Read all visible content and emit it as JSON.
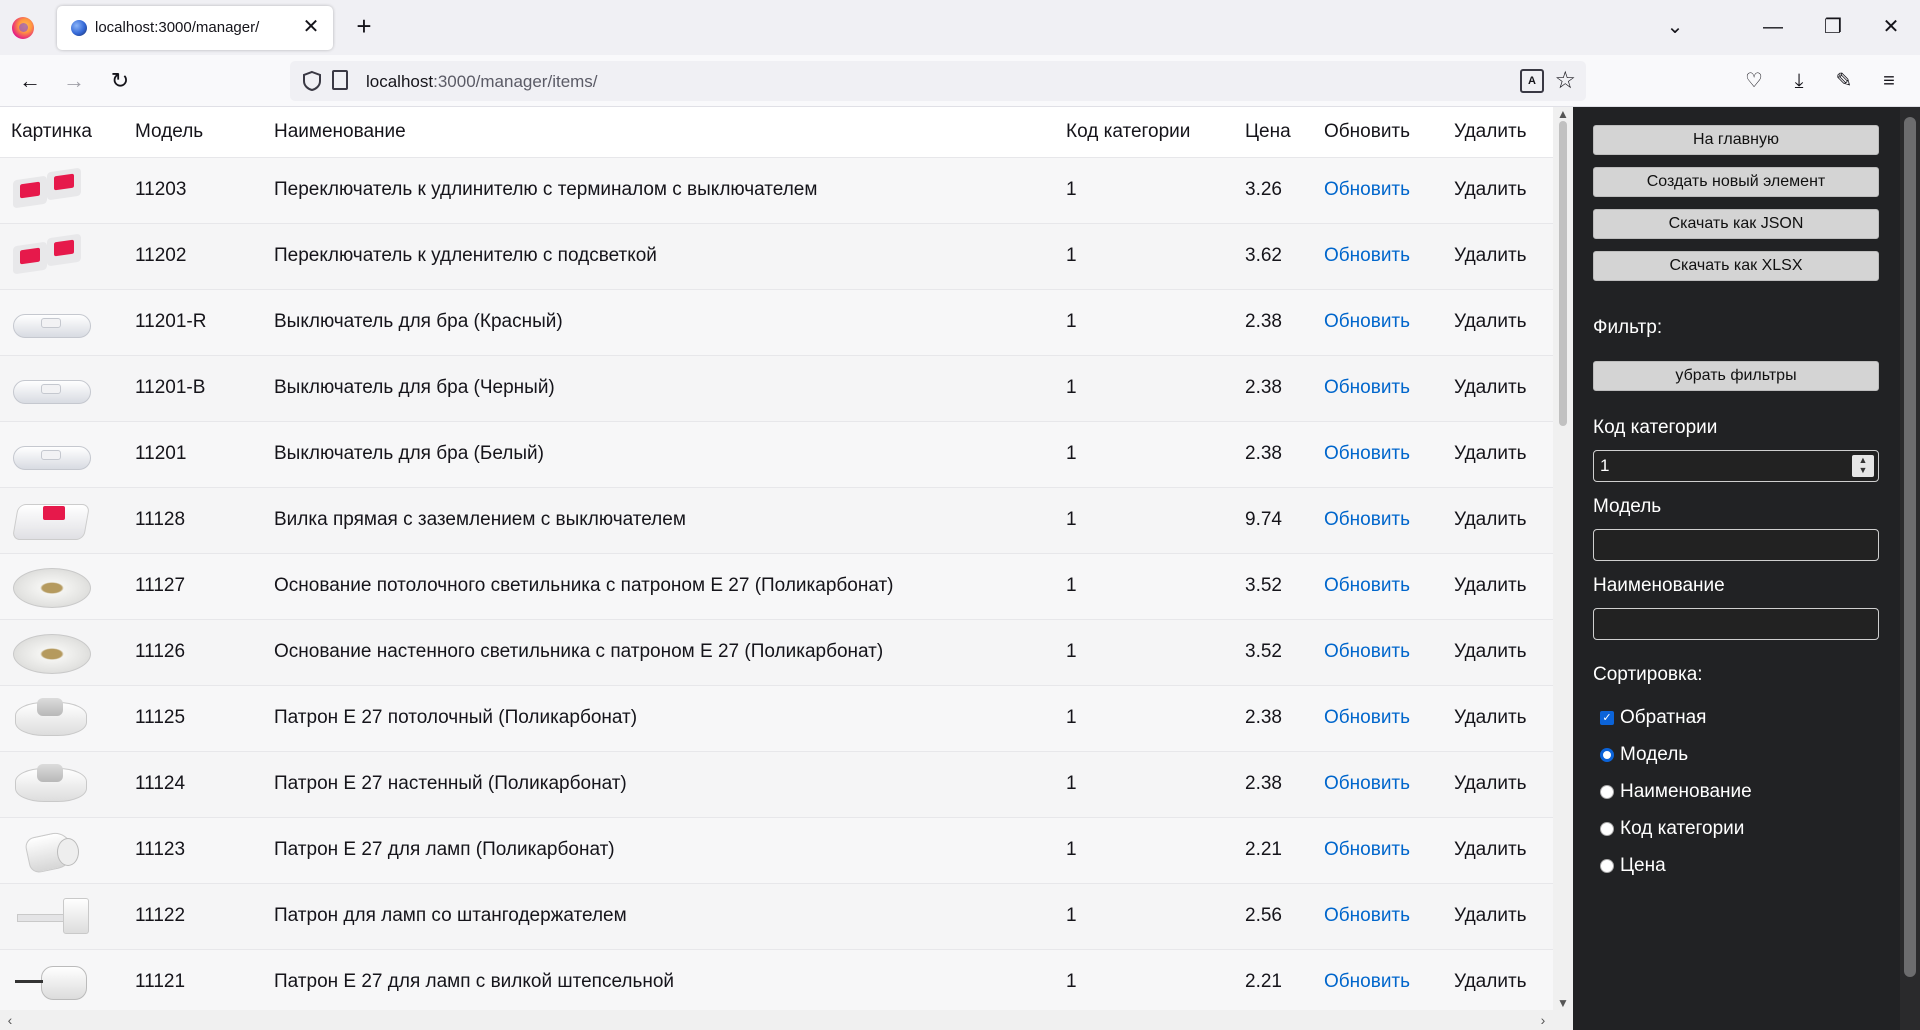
{
  "browser": {
    "tab_title": "localhost:3000/manager/",
    "tab_close": "✕",
    "new_tab": "+",
    "url_host": "localhost",
    "url_rest": ":3000/manager/items/",
    "win_min": "—",
    "win_max": "❐",
    "win_close": "✕",
    "list_tabs": "⌄"
  },
  "table": {
    "headers": {
      "image": "Картинка",
      "model": "Модель",
      "name": "Наименование",
      "category": "Код категории",
      "price": "Цена",
      "update": "Обновить",
      "delete": "Удалить"
    },
    "rows": [
      {
        "thumb": "switch-red",
        "model": "11203",
        "name": "Переключатель к удлинителю с терминалом с выключателем",
        "category": "1",
        "price": "3.26",
        "update": "Обновить",
        "delete": "Удалить"
      },
      {
        "thumb": "switch-red",
        "model": "11202",
        "name": "Переключатель к удленителю с подсветкой",
        "category": "1",
        "price": "3.62",
        "update": "Обновить",
        "delete": "Удалить"
      },
      {
        "thumb": "cord",
        "model": "11201-R",
        "name": "Выключатель для бра (Красный)",
        "category": "1",
        "price": "2.38",
        "update": "Обновить",
        "delete": "Удалить"
      },
      {
        "thumb": "cord",
        "model": "11201-B",
        "name": "Выключатель для бра (Черный)",
        "category": "1",
        "price": "2.38",
        "update": "Обновить",
        "delete": "Удалить"
      },
      {
        "thumb": "cord",
        "model": "11201",
        "name": "Выключатель для бра (Белый)",
        "category": "1",
        "price": "2.38",
        "update": "Обновить",
        "delete": "Удалить"
      },
      {
        "thumb": "plug",
        "model": "11128",
        "name": "Вилка прямая с заземлением с выключателем",
        "category": "1",
        "price": "9.74",
        "update": "Обновить",
        "delete": "Удалить"
      },
      {
        "thumb": "ceil",
        "model": "11127",
        "name": "Основание потолочного светильника с патроном Е 27 (Поликарбонат)",
        "category": "1",
        "price": "3.52",
        "update": "Обновить",
        "delete": "Удалить"
      },
      {
        "thumb": "ceil",
        "model": "11126",
        "name": "Основание настенного светильника с патроном Е 27 (Поликарбонат)",
        "category": "1",
        "price": "3.52",
        "update": "Обновить",
        "delete": "Удалить"
      },
      {
        "thumb": "holder",
        "model": "11125",
        "name": "Патрон Е 27 потолочный (Поликарбонат)",
        "category": "1",
        "price": "2.38",
        "update": "Обновить",
        "delete": "Удалить"
      },
      {
        "thumb": "holder",
        "model": "11124",
        "name": "Патрон Е 27 настенный (Поликарбонат)",
        "category": "1",
        "price": "2.38",
        "update": "Обновить",
        "delete": "Удалить"
      },
      {
        "thumb": "lamp",
        "model": "11123",
        "name": "Патрон Е 27 для ламп (Поликарбонат)",
        "category": "1",
        "price": "2.21",
        "update": "Обновить",
        "delete": "Удалить"
      },
      {
        "thumb": "rod",
        "model": "11122",
        "name": "Патрон для ламп со штангодержателем",
        "category": "1",
        "price": "2.56",
        "update": "Обновить",
        "delete": "Удалить"
      },
      {
        "thumb": "socketplug",
        "model": "11121",
        "name": "Патрон Е 27 для ламп с вилкой штепсельной",
        "category": "1",
        "price": "2.21",
        "update": "Обновить",
        "delete": "Удалить"
      }
    ]
  },
  "sidebar": {
    "home": "На главную",
    "create": "Создать новый элемент",
    "json": "Скачать как JSON",
    "xlsx": "Скачать как XLSX",
    "filter_label": "Фильтр:",
    "clear_filters": "убрать фильтры",
    "category_label": "Код категории",
    "category_value": "1",
    "model_label": "Модель",
    "model_value": "",
    "name_label": "Наименование",
    "name_value": "",
    "sort_label": "Сортировка:",
    "reverse": "Обратная",
    "reverse_checked": true,
    "sort_options": [
      "Модель",
      "Наименование",
      "Код категории",
      "Цена"
    ],
    "sort_selected": "Модель"
  }
}
